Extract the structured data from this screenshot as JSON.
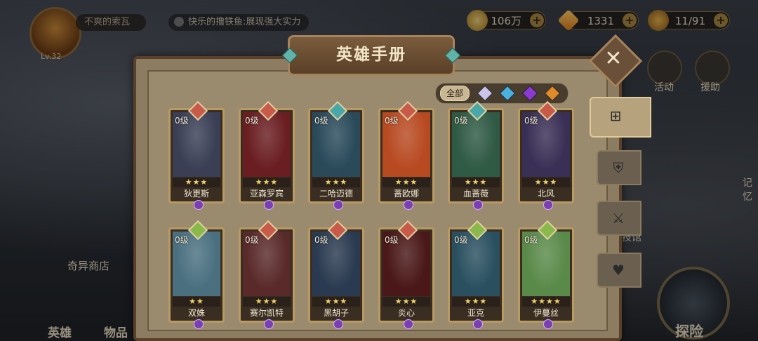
{
  "hud": {
    "player_name": "不爽的索瓦",
    "level": "Lv.32",
    "chat_message": "快乐的撸铁鱼:展现强大实力",
    "gold": "106万",
    "diamonds": "1331",
    "stamina": "11/91"
  },
  "side": {
    "activity_label": "活动",
    "assist_label": "援助",
    "memory_label": "记忆",
    "arena_label": "竞技馆"
  },
  "bottom": {
    "hero_label": "英雄",
    "item_label": "物品",
    "shop_label": "奇异商店",
    "explore_label": "探险"
  },
  "panel": {
    "title": "英雄手册",
    "filter_all": "全部",
    "tabs": [
      "all-tab",
      "defense-tab",
      "attack-tab",
      "heal-tab"
    ],
    "heroes": [
      {
        "name": "狄更斯",
        "level": "0级",
        "stars": "★★★",
        "faction": "#c85a4a",
        "art": "#3a3f55"
      },
      {
        "name": "亚森罗宾",
        "level": "0级",
        "stars": "★★★",
        "faction": "#c85a4a",
        "art": "#6a1e22"
      },
      {
        "name": "二哈迈德",
        "level": "0级",
        "stars": "★★★",
        "faction": "#4aa7a8",
        "art": "#2a4a5a"
      },
      {
        "name": "蔷欧娜",
        "level": "0级",
        "stars": "★★★",
        "faction": "#c85a4a",
        "art": "#b84a22"
      },
      {
        "name": "血蔷薇",
        "level": "0级",
        "stars": "★★★",
        "faction": "#4aa7a8",
        "art": "#2f5a44"
      },
      {
        "name": "北风",
        "level": "0级",
        "stars": "★★★",
        "faction": "#c85a4a",
        "art": "#3a2f55"
      },
      {
        "name": "双姝",
        "level": "0级",
        "stars": "★★",
        "faction": "#8ab84a",
        "art": "#4a7080"
      },
      {
        "name": "赛尔凯特",
        "level": "0级",
        "stars": "★★★",
        "faction": "#c85a4a",
        "art": "#5a2a2a"
      },
      {
        "name": "黑胡子",
        "level": "0级",
        "stars": "★★★",
        "faction": "#c85a4a",
        "art": "#2a3a50"
      },
      {
        "name": "炎心",
        "level": "0级",
        "stars": "★★★",
        "faction": "#c85a4a",
        "art": "#4a1818"
      },
      {
        "name": "亚克",
        "level": "0级",
        "stars": "★★★",
        "faction": "#8ab84a",
        "art": "#2a5060"
      },
      {
        "name": "伊蔓丝",
        "level": "0级",
        "stars": "★★★★",
        "faction": "#8ab84a",
        "art": "#5a8a4a"
      }
    ]
  },
  "colors": {
    "panel_bg": "#9a8a6e",
    "frame_gold": "#b89a62",
    "star": "#f2d36a"
  }
}
